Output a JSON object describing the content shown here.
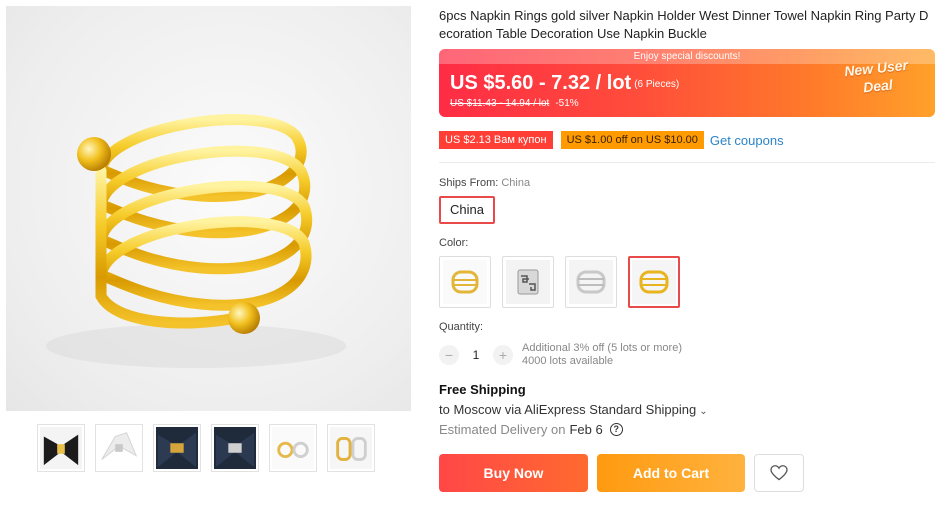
{
  "product": {
    "title": "6pcs Napkin Rings gold silver Napkin Holder West Dinner Towel Napkin Ring Party Decoration Table Decoration Use Napkin Buckle"
  },
  "price": {
    "discount_strip": "Enjoy special discounts!",
    "range": "US $5.60 - 7.32 / lot",
    "pieces": "(6 Pieces)",
    "original": "US $11.43 - 14.94 / lot",
    "percent_off": "-51%",
    "deal_line1": "New User",
    "deal_line2": "Deal"
  },
  "coupons": {
    "coupon1": "US $2.13 Вам купон",
    "coupon2": "US $1.00 off on US $10.00",
    "get_coupons": "Get coupons"
  },
  "ships_from": {
    "label": "Ships From:",
    "value": "China",
    "option": "China"
  },
  "color": {
    "label": "Color:",
    "swatches": [
      "gold-spiral",
      "silver-greek",
      "silver-spiral",
      "gold-spiral-selected"
    ],
    "selected_index": 3
  },
  "quantity": {
    "label": "Quantity:",
    "value": "1",
    "minus": "−",
    "plus": "+",
    "note1": "Additional 3% off (5 lots or more)",
    "note2": "4000 lots available"
  },
  "shipping": {
    "title": "Free Shipping",
    "via": "to Moscow via AliExpress Standard Shipping",
    "chevron": "⌄",
    "est_label": "Estimated Delivery on",
    "est_date": "Feb 6",
    "help": "?"
  },
  "actions": {
    "buy_now": "Buy Now",
    "add_to_cart": "Add to Cart"
  },
  "icons": {
    "wishlist": "heart-icon",
    "help": "question-circle-icon"
  },
  "colors": {
    "accent_red": "#ff4747",
    "accent_orange": "#ff9a10",
    "link_blue": "#2a84c9",
    "gold": "#f2c01e"
  }
}
